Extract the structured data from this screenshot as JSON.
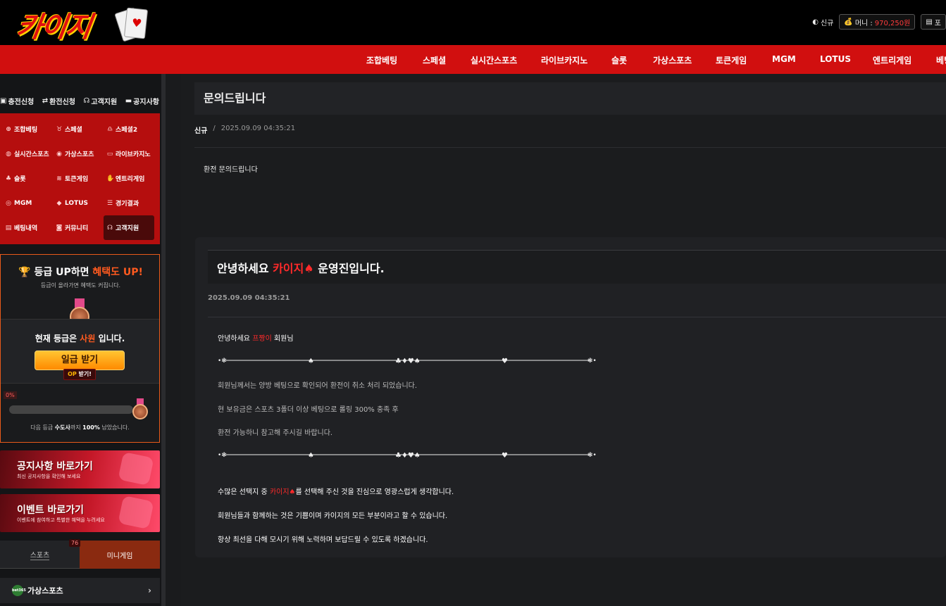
{
  "header": {
    "logo_text": "카이지",
    "user_name": "신규",
    "money_label": "머니 :",
    "money_value": "970,250원",
    "box2_label": "포"
  },
  "main_nav": [
    "조합베팅",
    "스페셜",
    "실시간스포츠",
    "라이브카지노",
    "슬롯",
    "가상스포츠",
    "토큰게임",
    "MGM",
    "LOTUS",
    "엔트리게임",
    "베팅"
  ],
  "sidebar": {
    "quick": [
      "충전신청",
      "환전신청",
      "고객지원",
      "공지사항"
    ],
    "grid": [
      {
        "label": "조합베팅",
        "icon": "soccer-icon"
      },
      {
        "label": "스페셜",
        "icon": "medal-icon"
      },
      {
        "label": "스페셜2",
        "icon": "award-icon"
      },
      {
        "label": "실시간스포츠",
        "icon": "football-icon"
      },
      {
        "label": "가상스포츠",
        "icon": "basketball-icon"
      },
      {
        "label": "라이브카지노",
        "icon": "ticket-icon"
      },
      {
        "label": "슬롯",
        "icon": "slot-icon"
      },
      {
        "label": "토큰게임",
        "icon": "coins-icon"
      },
      {
        "label": "엔트리게임",
        "icon": "hand-icon"
      },
      {
        "label": "MGM",
        "icon": "circle-icon"
      },
      {
        "label": "LOTUS",
        "icon": "diamond-icon"
      },
      {
        "label": "경기결과",
        "icon": "list-icon"
      },
      {
        "label": "베팅내역",
        "icon": "receipt-icon"
      },
      {
        "label": "커뮤니티",
        "icon": "chat-icon"
      },
      {
        "label": "고객지원",
        "icon": "headset-icon"
      }
    ],
    "grade": {
      "title_pre": "등급 UP하면 ",
      "title_hl": "혜택도 UP!",
      "subtitle": "등급이 올라가면 혜택도 커집니다.",
      "current_pre": "현재 등급은 ",
      "current_grade": "사원",
      "current_post": " 입니다.",
      "daily_button": "일급 받기",
      "op_label": "OP",
      "op_suffix": " 받기!",
      "progress_text": "0%",
      "progress_value": 0,
      "next_pre": "다음 등급 ",
      "next_grade": "수도사",
      "next_mid": "까지 ",
      "next_pct": "100%",
      "next_post": " 남았습니다."
    },
    "banners": [
      {
        "title": "공지사항 바로가기",
        "sub": "최신 공지사항을 확인해 보세요"
      },
      {
        "title": "이벤트 바로가기",
        "sub": "이벤트에 참여하고 특별한 혜택을 누려세요"
      }
    ],
    "tabs": {
      "sports": "스포츠",
      "mini": "미니게임",
      "badge": "76"
    },
    "vsports": {
      "label": "가상스포츠",
      "logo": "bet365"
    }
  },
  "post": {
    "title": "문의드립니다",
    "author": "신규",
    "sep": "/",
    "date": "2025.09.09 04:35:21",
    "body": "환전 문의드립니다"
  },
  "reply": {
    "head_pre": "안녕하세요 ",
    "head_brand": "카이지♠",
    "head_post": " 운영진입니다.",
    "date": "2025.09.09 04:35:21",
    "greet_pre": "안녕하세요 ",
    "greet_name": "프짱이",
    "greet_post": " 회원님",
    "l1": "회원님께서는 양방 베팅으로 확인되어 환전이 취소 처리 되었습니다.",
    "l2": "현 보유금은 스포츠 3폴더 이상 베팅으로 롤링 300% 충족 후",
    "l3": "환전 가능하니 참고해 주시길 바랍니다.",
    "c1_pre": "수많은 선택지 중 ",
    "c1_brand": "카이지♠",
    "c1_post": "를 선택해 주신 것을 진심으로 영광스럽게 생각합니다.",
    "c2": "회원님들과 함께하는 것은 기쁨이며 카이지의 모든 부분이라고 할 수 있습니다.",
    "c3": "항상 최선을 다해 모시기 위해 노력하며 보답드릴 수 있도록 하겠습니다."
  }
}
